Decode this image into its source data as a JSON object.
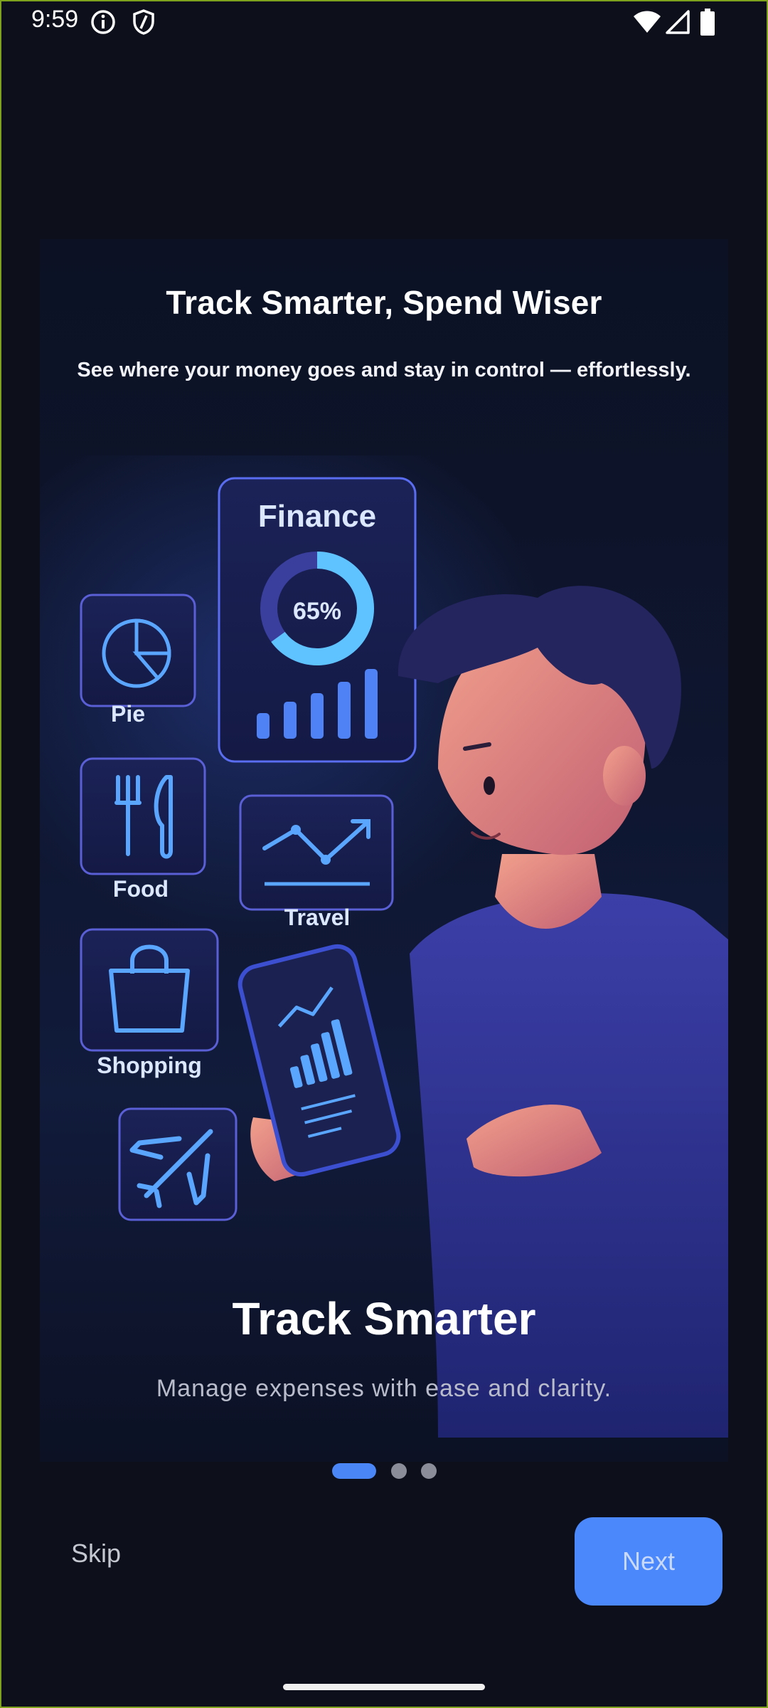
{
  "status_bar": {
    "time": "9:59",
    "icons": [
      "info-icon",
      "shield-icon",
      "wifi-icon",
      "signal-icon",
      "battery-icon"
    ]
  },
  "onboarding": {
    "headline": "Track Smarter, Spend Wiser",
    "subline": "See where your money goes and stay in control — effortlessly.",
    "illustration": {
      "finance_label": "Finance",
      "percent_label": "65%",
      "percent_value": 0.65,
      "category_labels": [
        "Pie",
        "Food",
        "Travel",
        "Shopping"
      ]
    },
    "slide_title": "Track Smarter",
    "slide_description": "Manage expenses with ease and clarity.",
    "pagination": {
      "current": 1,
      "total": 3
    }
  },
  "buttons": {
    "skip_label": "Skip",
    "next_label": "Next"
  },
  "colors": {
    "background": "#0d0f1a",
    "accent": "#4b88fb",
    "inactive_dot": "#8b8e99"
  }
}
